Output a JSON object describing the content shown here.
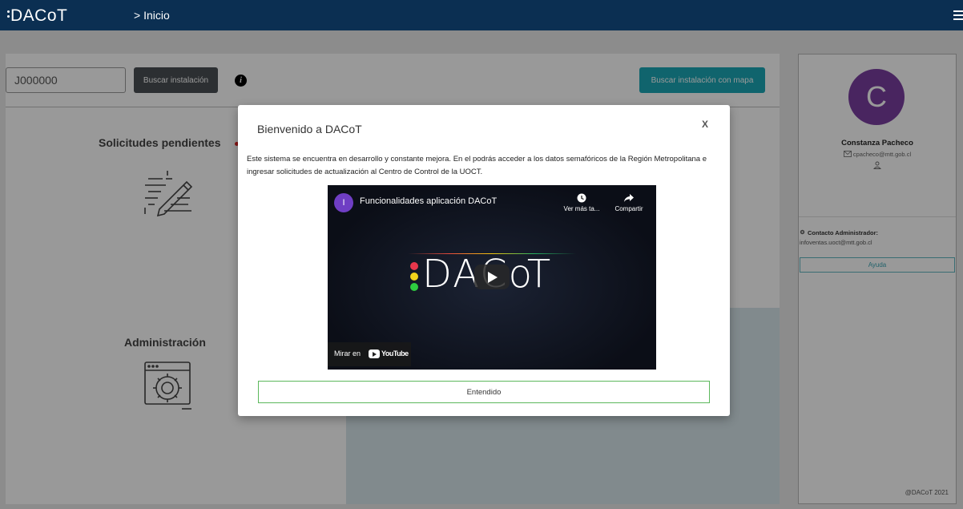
{
  "header": {
    "brand": "DACoT",
    "breadcrumb": "> Inicio"
  },
  "search": {
    "input_value": "J000000",
    "search_button": "Buscar instalación",
    "map_button": "Buscar instalación con mapa"
  },
  "cards": {
    "pending_title": "Solicitudes pendientes",
    "admin_title": "Administración"
  },
  "profile": {
    "avatar_initial": "C",
    "name": "Constanza Pacheco",
    "email": "cpacheco@mtt.gob.cl",
    "admin_contact_label": "Contacto Administrador:",
    "admin_contact_email": "infoventas.uoct@mtt.gob.cl",
    "help_button": "Ayuda",
    "footer": "@DACoT 2021"
  },
  "modal": {
    "title": "Bienvenido a DACoT",
    "close_label": "X",
    "body": "Este sistema se encuentra en desarrollo y constante mejora. En el podrás acceder a los datos semafóricos de la Región Metropolitana e ingresar solicitudes de actualización al Centro de Control de la UOCT.",
    "confirm_button": "Entendido",
    "video": {
      "channel_initial": "I",
      "title": "Funcionalidades aplicación DACoT",
      "watch_later": "Ver más ta...",
      "share": "Compartir",
      "logo_text": "DACoT",
      "watch_on": "Mirar en",
      "youtube_brand": "YouTube",
      "traffic_colors": [
        "#e8374c",
        "#f2d31b",
        "#2ecc40"
      ]
    }
  }
}
